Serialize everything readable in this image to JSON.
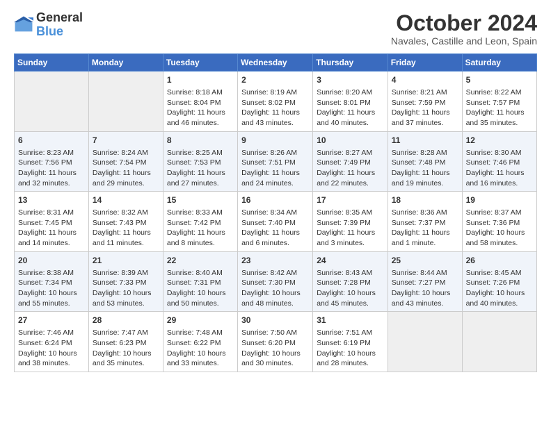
{
  "logo": {
    "line1": "General",
    "line2": "Blue"
  },
  "title": "October 2024",
  "subtitle": "Navales, Castille and Leon, Spain",
  "headers": [
    "Sunday",
    "Monday",
    "Tuesday",
    "Wednesday",
    "Thursday",
    "Friday",
    "Saturday"
  ],
  "weeks": [
    [
      {
        "num": "",
        "info": ""
      },
      {
        "num": "",
        "info": ""
      },
      {
        "num": "1",
        "info": "Sunrise: 8:18 AM\nSunset: 8:04 PM\nDaylight: 11 hours and 46 minutes."
      },
      {
        "num": "2",
        "info": "Sunrise: 8:19 AM\nSunset: 8:02 PM\nDaylight: 11 hours and 43 minutes."
      },
      {
        "num": "3",
        "info": "Sunrise: 8:20 AM\nSunset: 8:01 PM\nDaylight: 11 hours and 40 minutes."
      },
      {
        "num": "4",
        "info": "Sunrise: 8:21 AM\nSunset: 7:59 PM\nDaylight: 11 hours and 37 minutes."
      },
      {
        "num": "5",
        "info": "Sunrise: 8:22 AM\nSunset: 7:57 PM\nDaylight: 11 hours and 35 minutes."
      }
    ],
    [
      {
        "num": "6",
        "info": "Sunrise: 8:23 AM\nSunset: 7:56 PM\nDaylight: 11 hours and 32 minutes."
      },
      {
        "num": "7",
        "info": "Sunrise: 8:24 AM\nSunset: 7:54 PM\nDaylight: 11 hours and 29 minutes."
      },
      {
        "num": "8",
        "info": "Sunrise: 8:25 AM\nSunset: 7:53 PM\nDaylight: 11 hours and 27 minutes."
      },
      {
        "num": "9",
        "info": "Sunrise: 8:26 AM\nSunset: 7:51 PM\nDaylight: 11 hours and 24 minutes."
      },
      {
        "num": "10",
        "info": "Sunrise: 8:27 AM\nSunset: 7:49 PM\nDaylight: 11 hours and 22 minutes."
      },
      {
        "num": "11",
        "info": "Sunrise: 8:28 AM\nSunset: 7:48 PM\nDaylight: 11 hours and 19 minutes."
      },
      {
        "num": "12",
        "info": "Sunrise: 8:30 AM\nSunset: 7:46 PM\nDaylight: 11 hours and 16 minutes."
      }
    ],
    [
      {
        "num": "13",
        "info": "Sunrise: 8:31 AM\nSunset: 7:45 PM\nDaylight: 11 hours and 14 minutes."
      },
      {
        "num": "14",
        "info": "Sunrise: 8:32 AM\nSunset: 7:43 PM\nDaylight: 11 hours and 11 minutes."
      },
      {
        "num": "15",
        "info": "Sunrise: 8:33 AM\nSunset: 7:42 PM\nDaylight: 11 hours and 8 minutes."
      },
      {
        "num": "16",
        "info": "Sunrise: 8:34 AM\nSunset: 7:40 PM\nDaylight: 11 hours and 6 minutes."
      },
      {
        "num": "17",
        "info": "Sunrise: 8:35 AM\nSunset: 7:39 PM\nDaylight: 11 hours and 3 minutes."
      },
      {
        "num": "18",
        "info": "Sunrise: 8:36 AM\nSunset: 7:37 PM\nDaylight: 11 hours and 1 minute."
      },
      {
        "num": "19",
        "info": "Sunrise: 8:37 AM\nSunset: 7:36 PM\nDaylight: 10 hours and 58 minutes."
      }
    ],
    [
      {
        "num": "20",
        "info": "Sunrise: 8:38 AM\nSunset: 7:34 PM\nDaylight: 10 hours and 55 minutes."
      },
      {
        "num": "21",
        "info": "Sunrise: 8:39 AM\nSunset: 7:33 PM\nDaylight: 10 hours and 53 minutes."
      },
      {
        "num": "22",
        "info": "Sunrise: 8:40 AM\nSunset: 7:31 PM\nDaylight: 10 hours and 50 minutes."
      },
      {
        "num": "23",
        "info": "Sunrise: 8:42 AM\nSunset: 7:30 PM\nDaylight: 10 hours and 48 minutes."
      },
      {
        "num": "24",
        "info": "Sunrise: 8:43 AM\nSunset: 7:28 PM\nDaylight: 10 hours and 45 minutes."
      },
      {
        "num": "25",
        "info": "Sunrise: 8:44 AM\nSunset: 7:27 PM\nDaylight: 10 hours and 43 minutes."
      },
      {
        "num": "26",
        "info": "Sunrise: 8:45 AM\nSunset: 7:26 PM\nDaylight: 10 hours and 40 minutes."
      }
    ],
    [
      {
        "num": "27",
        "info": "Sunrise: 7:46 AM\nSunset: 6:24 PM\nDaylight: 10 hours and 38 minutes."
      },
      {
        "num": "28",
        "info": "Sunrise: 7:47 AM\nSunset: 6:23 PM\nDaylight: 10 hours and 35 minutes."
      },
      {
        "num": "29",
        "info": "Sunrise: 7:48 AM\nSunset: 6:22 PM\nDaylight: 10 hours and 33 minutes."
      },
      {
        "num": "30",
        "info": "Sunrise: 7:50 AM\nSunset: 6:20 PM\nDaylight: 10 hours and 30 minutes."
      },
      {
        "num": "31",
        "info": "Sunrise: 7:51 AM\nSunset: 6:19 PM\nDaylight: 10 hours and 28 minutes."
      },
      {
        "num": "",
        "info": ""
      },
      {
        "num": "",
        "info": ""
      }
    ]
  ]
}
